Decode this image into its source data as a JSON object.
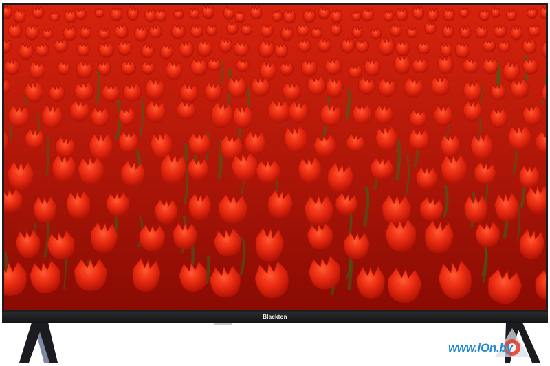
{
  "product": {
    "brand_label": "Blackton"
  },
  "watermark": {
    "text": "www.iOn.by"
  },
  "colors": {
    "bezel": "#1c1d20",
    "tulip_light": "#f0381c",
    "tulip_dark": "#b81306",
    "leaf": "#2f6a1e",
    "watermark_blue": "#1e88d6"
  },
  "icons": [
    "tulip-field-image",
    "stand-foot-icon",
    "watermark-logo-icon"
  ]
}
